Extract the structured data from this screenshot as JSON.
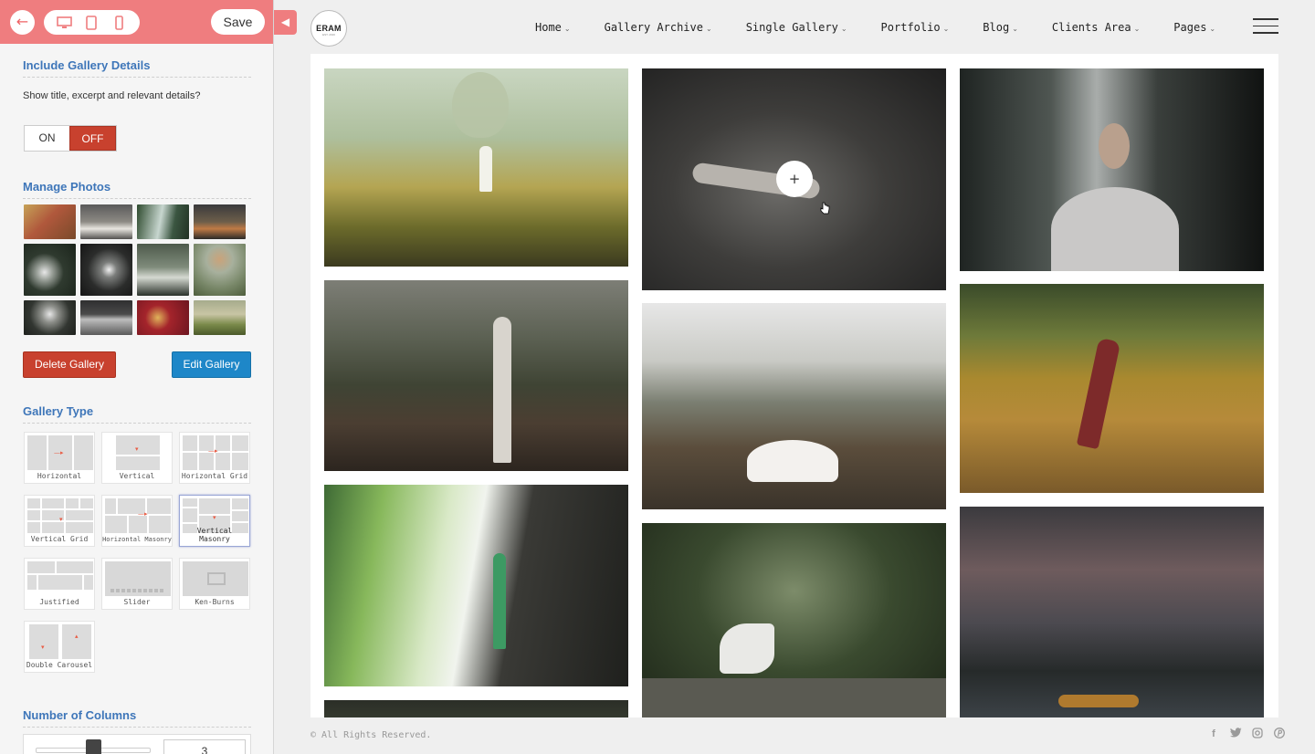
{
  "panel": {
    "save_label": "Save",
    "include_details": {
      "title": "Include Gallery Details",
      "description": "Show title, excerpt and relevant details?",
      "on_label": "ON",
      "off_label": "OFF",
      "selected": "OFF"
    },
    "manage_photos": {
      "title": "Manage Photos",
      "delete_label": "Delete Gallery",
      "edit_label": "Edit Gallery"
    },
    "gallery_type": {
      "title": "Gallery Type",
      "options": [
        "Horizontal",
        "Vertical",
        "Horizontal Grid",
        "Vertical Grid",
        "Horizontal Masonry",
        "Vertical Masonry",
        "Justified",
        "Slider",
        "Ken-Burns",
        "Double Carousel"
      ],
      "selected": "Vertical Masonry"
    },
    "columns": {
      "title": "Number of Columns",
      "value": "3"
    }
  },
  "site": {
    "logo_text": "ERAM",
    "logo_subtext": "EST. 2016",
    "nav": [
      "Home",
      "Gallery Archive",
      "Single Gallery",
      "Portfolio",
      "Blog",
      "Clients Area",
      "Pages"
    ],
    "footer_text": "© All Rights Reserved.",
    "social_icons": [
      "facebook-icon",
      "twitter-icon",
      "instagram-icon",
      "pinterest-icon"
    ]
  },
  "colors": {
    "panel_header": "#ef7d7f",
    "section_title": "#3e76b9",
    "off_button": "#c8412e",
    "delete_button": "#c8412e",
    "edit_button": "#1e87c8"
  }
}
